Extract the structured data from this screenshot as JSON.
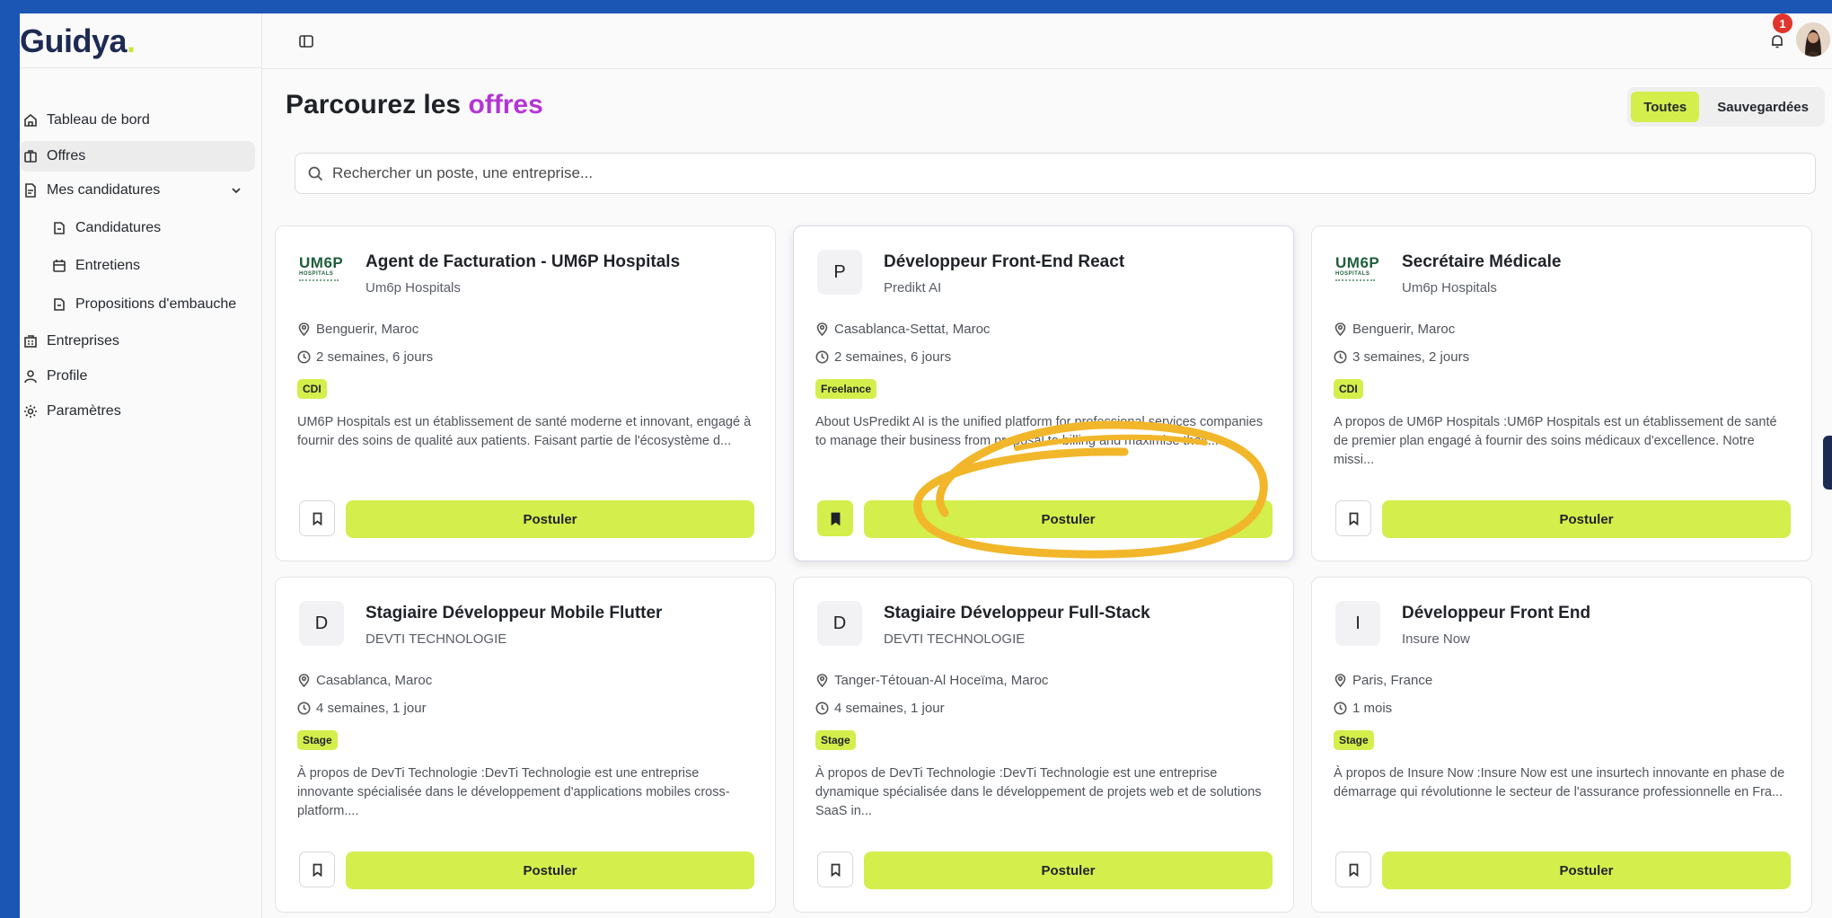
{
  "app": {
    "logo_text": "Guidya",
    "notification_count": "1"
  },
  "sidebar": {
    "items": [
      {
        "label": "Tableau de bord",
        "icon": "home-icon"
      },
      {
        "label": "Offres",
        "icon": "briefcase-icon",
        "active": true
      },
      {
        "label": "Mes candidatures",
        "icon": "file-icon"
      },
      {
        "label": "Candidatures",
        "icon": "doc-icon"
      },
      {
        "label": "Entretiens",
        "icon": "calendar-icon"
      },
      {
        "label": "Propositions d'embauche",
        "icon": "doc-icon"
      },
      {
        "label": "Entreprises",
        "icon": "building-icon"
      },
      {
        "label": "Profile",
        "icon": "user-icon"
      },
      {
        "label": "Paramètres",
        "icon": "gear-icon"
      }
    ]
  },
  "main": {
    "title_prefix": "Parcourez les",
    "title_accent": "offres",
    "filters": [
      "Toutes",
      "Sauvegardées"
    ],
    "search_placeholder": "Rechercher un poste, une entreprise..."
  },
  "jobs": [
    {
      "logo": "UM6P",
      "logo_sub": "HOSPITALS",
      "title": "Agent de Facturation - UM6P Hospitals",
      "company": "Um6p Hospitals",
      "location": "Benguerir, Maroc",
      "posted": "2 semaines, 6 jours",
      "type": "CDI",
      "description": "UM6P Hospitals est un établissement de santé moderne et innovant, engagé à fournir des soins de qualité aux patients. Faisant partie de l'écosystème d...",
      "apply_label": "Postuler",
      "saved": false
    },
    {
      "logo": "P",
      "title": "Développeur Front-End React",
      "company": "Predikt AI",
      "location": "Casablanca-Settat, Maroc",
      "posted": "2 semaines, 6 jours",
      "type": "Freelance",
      "description": "About UsPredikt AI is the unified platform for professional services companies to manage their business from proposal to billing and maximise their...",
      "apply_label": "Postuler",
      "saved": true
    },
    {
      "logo": "UM6P",
      "logo_sub": "HOSPITALS",
      "title": "Secrétaire Médicale",
      "company": "Um6p Hospitals",
      "location": "Benguerir, Maroc",
      "posted": "3 semaines, 2 jours",
      "type": "CDI",
      "description": "A propos de UM6P Hospitals :UM6P Hospitals est un établissement de santé de premier plan engagé à fournir des soins médicaux d'excellence. Notre missi...",
      "apply_label": "Postuler",
      "saved": false
    },
    {
      "logo": "D",
      "title": "Stagiaire Développeur Mobile Flutter",
      "company": "DEVTI TECHNOLOGIE",
      "location": "Casablanca, Maroc",
      "posted": "4 semaines, 1 jour",
      "type": "Stage",
      "description": "À propos de DevTi Technologie :DevTi Technologie est une entreprise innovante spécialisée dans le développement d'applications mobiles cross-platform....",
      "apply_label": "Postuler",
      "saved": false
    },
    {
      "logo": "D",
      "title": "Stagiaire Développeur Full-Stack",
      "company": "DEVTI TECHNOLOGIE",
      "location": "Tanger-Tétouan-Al Hoceïma, Maroc",
      "posted": "4 semaines, 1 jour",
      "type": "Stage",
      "description": "À propos de DevTi Technologie :DevTi Technologie est une entreprise dynamique spécialisée dans le développement de projets web et de solutions SaaS in...",
      "apply_label": "Postuler",
      "saved": false
    },
    {
      "logo": "I",
      "title": "Développeur Front End",
      "company": "Insure Now",
      "location": "Paris, France",
      "posted": "1 mois",
      "type": "Stage",
      "description": "À propos de Insure Now :Insure Now est une insurtech innovante en phase de démarrage qui révolutionne le secteur de l'assurance professionnelle en Fra...",
      "apply_label": "Postuler",
      "saved": false
    }
  ],
  "colors": {
    "accent": "#d4ee4c",
    "title_accent": "#b534d6",
    "frame_bg": "#1c56b4",
    "annotation": "#f2b62a"
  }
}
